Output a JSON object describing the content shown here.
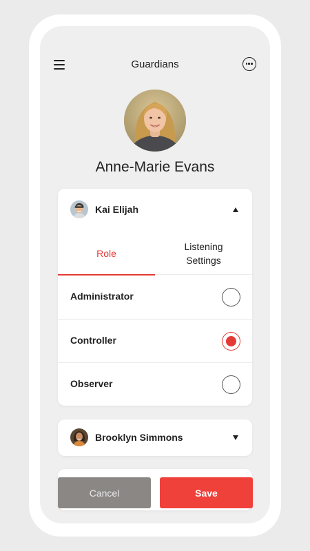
{
  "header": {
    "title": "Guardians",
    "menu_icon": "hamburger-menu-icon",
    "more_icon": "more-options-icon"
  },
  "profile": {
    "name": "Anne-Marie Evans"
  },
  "guardians": [
    {
      "name": "Kai Elijah",
      "expanded": true,
      "tabs": [
        {
          "label": "Role",
          "active": true
        },
        {
          "label": "Listening Settings",
          "active": false
        }
      ],
      "roles": [
        {
          "label": "Administrator",
          "selected": false
        },
        {
          "label": "Controller",
          "selected": true
        },
        {
          "label": "Observer",
          "selected": false
        }
      ]
    },
    {
      "name": "Brooklyn Simmons",
      "expanded": false
    }
  ],
  "actions": {
    "cancel_label": "Cancel",
    "save_label": "Save"
  },
  "colors": {
    "accent": "#e53935",
    "save_button": "#f0403a",
    "cancel_button": "#8a8785",
    "background": "#efefef"
  }
}
